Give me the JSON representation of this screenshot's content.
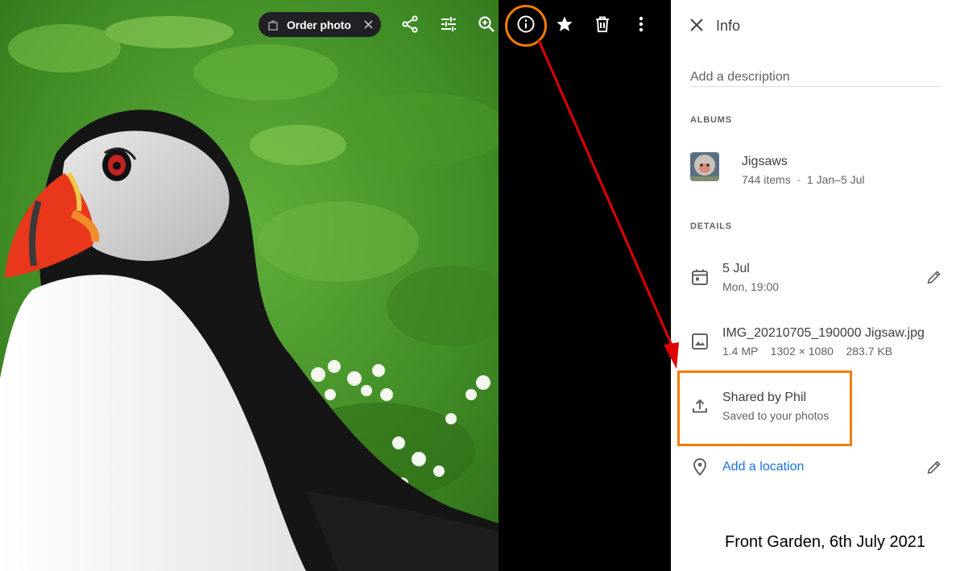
{
  "toolbar": {
    "order_photo_label": "Order photo",
    "icons": [
      "shopping-bag-icon",
      "close-icon",
      "share-icon",
      "edit-adjust-icon",
      "zoom-in-icon",
      "info-icon",
      "star-icon",
      "delete-icon",
      "more-vert-icon"
    ]
  },
  "panel": {
    "title": "Info",
    "description_placeholder": "Add a description",
    "albums_heading": "ALBUMS",
    "album": {
      "name": "Jigsaws",
      "meta": "744 items  ·  1 Jan–5 Jul"
    },
    "details_heading": "DETAILS",
    "date": {
      "main": "5 Jul",
      "sub": "Mon, 19:00"
    },
    "file": {
      "main": "IMG_20210705_190000 Jigsaw.jpg",
      "sub": "1.4 MP    1302 × 1080    283.7 KB"
    },
    "shared": {
      "main": "Shared by Phil",
      "sub": "Saved to your photos"
    },
    "location": {
      "link": "Add a location"
    }
  },
  "annotation": {
    "caption": "Front Garden, 6th July 2021",
    "highlight_color": "#f57c00",
    "arrow_color": "#e00000"
  },
  "colors": {
    "link": "#1a73e8",
    "text_primary": "#3c4043",
    "text_secondary": "#5f6368"
  }
}
